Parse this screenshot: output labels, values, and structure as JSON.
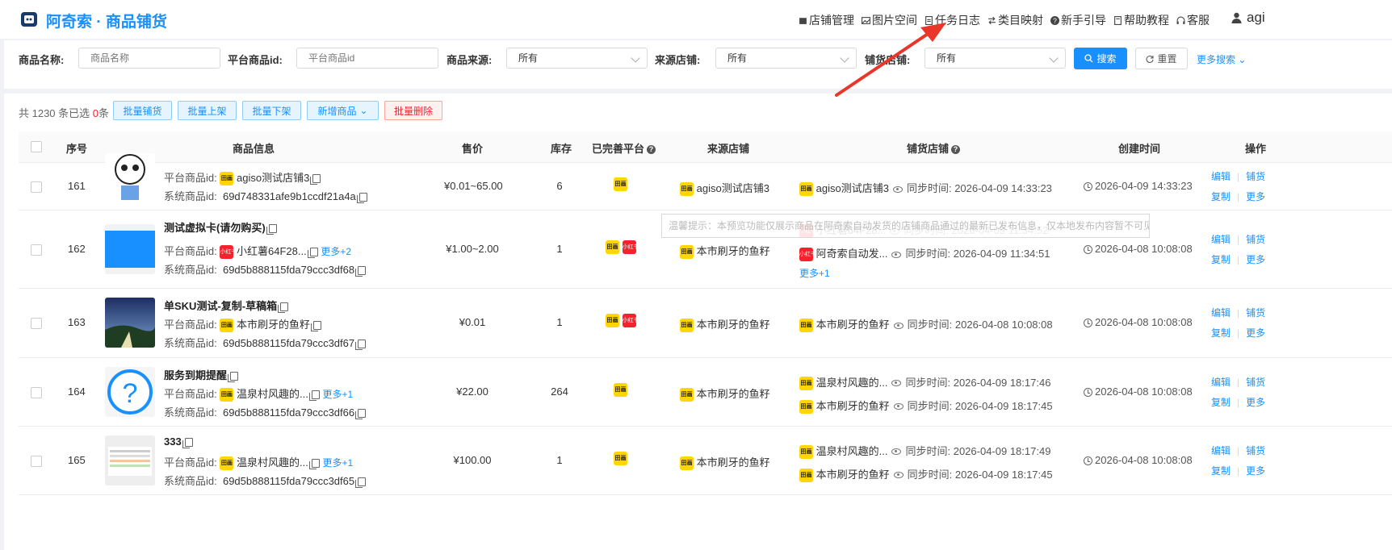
{
  "header": {
    "title": "阿奇索 · 商品铺货",
    "nav": [
      {
        "label": "店铺管理",
        "icon": "store-icon"
      },
      {
        "label": "图片空间",
        "icon": "image-icon"
      },
      {
        "label": "任务日志",
        "icon": "log-icon"
      },
      {
        "label": "类目映射",
        "icon": "mapping-icon"
      },
      {
        "label": "新手引导",
        "icon": "help-icon"
      },
      {
        "label": "帮助教程",
        "icon": "book-icon"
      },
      {
        "label": "客服",
        "icon": "headset-icon"
      }
    ],
    "user_partial": "agi"
  },
  "search": {
    "product_name_label": "商品名称:",
    "product_name_placeholder": "商品名称",
    "platform_id_label": "平台商品id:",
    "platform_id_placeholder": "平台商品id",
    "source_label": "商品来源:",
    "source_value": "所有",
    "source_store_label": "来源店铺:",
    "source_store_value": "所有",
    "dist_store_label": "铺货店铺:",
    "dist_store_value": "所有",
    "search_button": "搜索",
    "reset_button": "重置",
    "more_search": "更多搜索"
  },
  "toolbar": {
    "summary_prefix": "共 1230 条已选 ",
    "selected_count": "0",
    "summary_suffix": "条",
    "batch_distribute": "批量铺货",
    "batch_up": "批量上架",
    "batch_down": "批量下架",
    "add_product": "新增商品",
    "batch_delete": "批量删除"
  },
  "table": {
    "headers": {
      "index": "序号",
      "info": "商品信息",
      "price": "售价",
      "stock": "库存",
      "platform": "已完善平台",
      "source_store": "来源店铺",
      "dist_store": "铺货店铺",
      "created": "创建时间",
      "actions": "操作"
    },
    "platform_id_label": "平台商品id:",
    "system_id_label": "系统商品id:",
    "sync_label": "同步时间:",
    "actions": {
      "edit": "编辑",
      "distribute": "铺货",
      "copy": "复制",
      "more": "更多"
    },
    "rows": [
      {
        "index": "161",
        "name": "",
        "platform_store": "agiso测试店铺3",
        "platform_more": "",
        "system_id": "69d748331afe9b1ccdf21a4a",
        "price": "¥0.01~65.00",
        "stock": "6",
        "source_store": "agiso测试店铺3",
        "dist": [
          {
            "store": "agiso测试店铺3",
            "time": "2026-04-09 14:33:23"
          }
        ],
        "dist_more": "",
        "created": "2026-04-09 14:33:23"
      },
      {
        "index": "162",
        "name": "测试虚拟卡(请勿购买)",
        "platform_store": "小红薯64F28...",
        "platform_more": "更多+2",
        "system_id": "69d5b888115fda79ccc3df68",
        "price": "¥1.00~2.00",
        "stock": "1",
        "source_store": "本市刷牙的鱼籽",
        "dist": [
          {
            "store": "小红薯64F28...",
            "time": "2026-04-09 11:34:52"
          },
          {
            "store": "阿奇索自动发...",
            "time": "2026-04-09 11:34:51"
          }
        ],
        "dist_more": "更多+1",
        "created": "2026-04-08 10:08:08"
      },
      {
        "index": "163",
        "name": "单SKU测试-复制-草稿箱",
        "platform_store": "本市刷牙的鱼籽",
        "platform_more": "",
        "system_id": "69d5b888115fda79ccc3df67",
        "price": "¥0.01",
        "stock": "1",
        "source_store": "本市刷牙的鱼籽",
        "dist": [
          {
            "store": "本市刷牙的鱼籽",
            "time": "2026-04-08 10:08:08"
          }
        ],
        "dist_more": "",
        "created": "2026-04-08 10:08:08"
      },
      {
        "index": "164",
        "name": "服务到期提醒",
        "platform_store": "温泉村风趣的...",
        "platform_more": "更多+1",
        "system_id": "69d5b888115fda79ccc3df66",
        "price": "¥22.00",
        "stock": "264",
        "source_store": "本市刷牙的鱼籽",
        "dist": [
          {
            "store": "温泉村风趣的...",
            "time": "2026-04-09 18:17:46"
          },
          {
            "store": "本市刷牙的鱼籽",
            "time": "2026-04-09 18:17:45"
          }
        ],
        "dist_more": "",
        "created": "2026-04-08 10:08:08"
      },
      {
        "index": "165",
        "name": "333",
        "platform_store": "温泉村风趣的...",
        "platform_more": "更多+1",
        "system_id": "69d5b888115fda79ccc3df65",
        "price": "¥100.00",
        "stock": "1",
        "source_store": "本市刷牙的鱼籽",
        "dist": [
          {
            "store": "温泉村风趣的...",
            "time": "2026-04-09 18:17:49"
          },
          {
            "store": "本市刷牙的鱼籽",
            "time": "2026-04-09 18:17:45"
          }
        ],
        "dist_more": "",
        "created": "2026-04-08 10:08:08"
      }
    ]
  },
  "badges": {
    "yellow": "田画",
    "red": "小红书"
  },
  "tooltip": "温馨提示：本预览功能仅展示商品在阿奇索自动发货的店铺商品通过的最新已发布信息，仅本地发布内容暂不可见。",
  "colors": {
    "primary": "#1890ff",
    "danger": "#f5222d",
    "badge_yellow": "#ffd600",
    "annotation_arrow": "#e8362a"
  }
}
